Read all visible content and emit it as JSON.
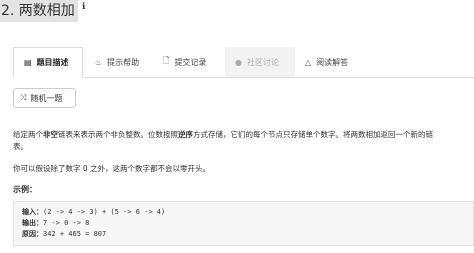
{
  "problem": {
    "title": "2. 两数相加",
    "info_icon": "info-icon"
  },
  "tabs": [
    {
      "label": "题目描述",
      "icon": "description-icon",
      "active": true
    },
    {
      "label": "提示帮助",
      "icon": "lightbulb-icon",
      "active": false
    },
    {
      "label": "提交记录",
      "icon": "file-icon",
      "active": false
    },
    {
      "label": "社区讨论",
      "icon": "comments-icon",
      "active": false,
      "disabled": true
    },
    {
      "label": "阅读解答",
      "icon": "flask-icon",
      "active": false
    }
  ],
  "random_button": {
    "label": "随机一题",
    "icon": "shuffle-icon"
  },
  "description": {
    "p1_a": "给定两个",
    "p1_b": "非空",
    "p1_c": "链表来表示两个非负整数。位数按照",
    "p1_d": "逆序",
    "p1_e": "方式存储，它们的每个节点只存储单个数字。将两数相加返回一个新的链",
    "p1_f": "表。",
    "p2": "你可以假设除了数字 0 之外，这两个数字都不会以零开头。"
  },
  "example": {
    "heading": "示例：",
    "input_label": "输入：",
    "input_value": "(2 -> 4 -> 3) + (5 -> 6 -> 4)",
    "output_label": "输出：",
    "output_value": "7 -> 0 -> 8",
    "reason_label": "原因：",
    "reason_value": "342 + 465 = 807"
  },
  "colors": {
    "title_bg": "#e3e3e3",
    "tab_border": "#dddddd",
    "code_bg": "#f6f6f6"
  }
}
